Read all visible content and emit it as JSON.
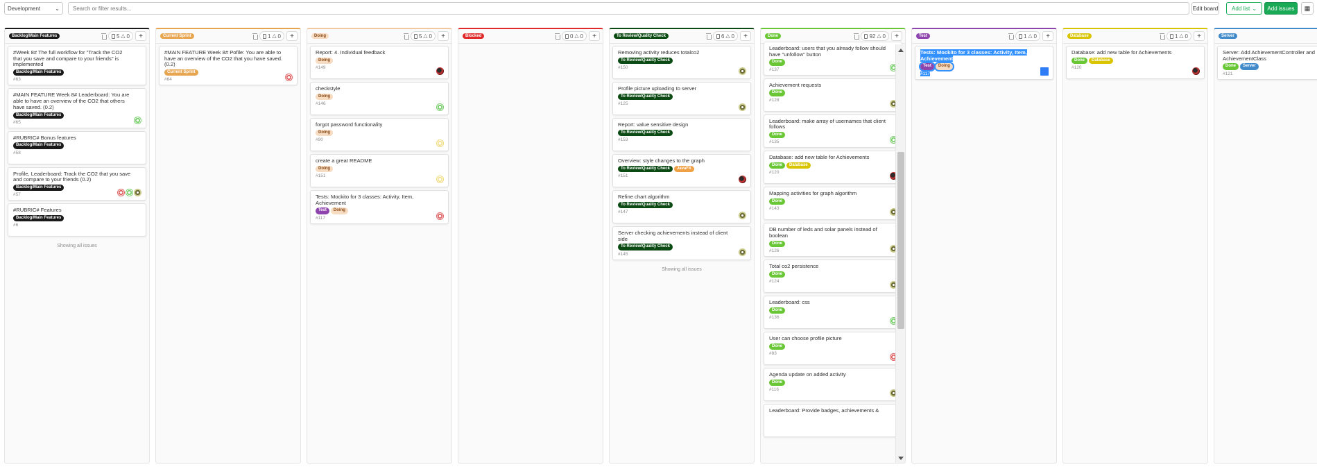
{
  "toolbar": {
    "milestone_select": "Development",
    "search_placeholder": "Search or filter results...",
    "edit_board": "Edit board",
    "add_list": "Add list",
    "add_issues": "Add issues"
  },
  "colors": {
    "backlog": "#1a1a1a",
    "current_sprint": "#e8a550",
    "doing": "#f2c8a0",
    "blocked": "#e02a2a",
    "review": "#0b4a12",
    "done": "#69c735",
    "test": "#8e44ad",
    "database": "#d8c400",
    "server": "#428bca",
    "javafx": "#f0a044"
  },
  "lists": [
    {
      "name": "Backlog/Main Features",
      "issues": "5",
      "weight": "0",
      "footer": "Showing all issues",
      "cards": [
        {
          "title": "#Week 8# The full workflow for \"Track the CO2 that you save and compare to your friends\" is implemented",
          "labels": [
            "Backlog/Main Features"
          ],
          "id": "#63",
          "avatars": []
        },
        {
          "title": "#MAIN FEATURE Week 8# Leaderboard: You are able to have an overview of the CO2 that others have saved. (0.2)",
          "labels": [
            "Backlog/Main Features"
          ],
          "id": "#65",
          "avatars": [
            "green"
          ]
        },
        {
          "title": "#RUBRIC# Bonus features",
          "labels": [
            "Backlog/Main Features"
          ],
          "id": "#58",
          "avatars": []
        },
        {
          "title": "Profile, Leaderboard: Track the CO2 that you save and compare to your friends (0.2)",
          "labels": [
            "Backlog/Main Features"
          ],
          "id": "#57",
          "avatars": [
            "red",
            "green",
            "olive"
          ]
        },
        {
          "title": "#RUBRIC# Features",
          "labels": [
            "Backlog/Main Features"
          ],
          "id": "#6",
          "avatars": []
        }
      ]
    },
    {
      "name": "Current Sprint",
      "issues": "1",
      "weight": "0",
      "cards": [
        {
          "title": "#MAIN FEATURE Week 8# Pofile: You are able to have an overview of the CO2 that you have saved. (0.2)",
          "labels": [
            "Current Sprint"
          ],
          "id": "#64",
          "avatars": [
            "red"
          ]
        }
      ]
    },
    {
      "name": "Doing",
      "issues": "5",
      "weight": "0",
      "cards": [
        {
          "title": "Report: 4. Individual feedback",
          "labels": [
            "Doing"
          ],
          "id": "#149",
          "avatars": [
            "photo"
          ]
        },
        {
          "title": "checkstyle",
          "labels": [
            "Doing"
          ],
          "id": "#146",
          "avatars": [
            "green"
          ]
        },
        {
          "title": "forgot password functionality",
          "labels": [
            "Doing"
          ],
          "id": "#90",
          "avatars": [
            "yellow"
          ]
        },
        {
          "title": "create a great README",
          "labels": [
            "Doing"
          ],
          "id": "#151",
          "avatars": [
            "yellow"
          ]
        },
        {
          "title": "Tests: Mockito for 3 classes: Activity, Item, Achievement",
          "labels": [
            "Test",
            "Doing"
          ],
          "id": "#117",
          "avatars": [
            "red"
          ]
        }
      ]
    },
    {
      "name": "Blocked",
      "issues": "0",
      "weight": "0",
      "cards": []
    },
    {
      "name": "To Review/Quality Check",
      "issues": "6",
      "weight": "0",
      "footer": "Showing all issues",
      "cards": [
        {
          "title": "Removing activity reduces totalco2",
          "labels": [
            "To Review/Quality Check"
          ],
          "id": "#150",
          "avatars": [
            "olive"
          ]
        },
        {
          "title": "Profile picture uploading to server",
          "labels": [
            "To Review/Quality Check"
          ],
          "id": "#125",
          "avatars": [
            "olive"
          ]
        },
        {
          "title": "Report: value sensitive design",
          "labels": [
            "To Review/Quality Check"
          ],
          "id": "#153",
          "avatars": []
        },
        {
          "title": "Overview: style changes to the graph",
          "labels": [
            "To Review/Quality Check",
            "JavaFX"
          ],
          "id": "#151",
          "avatars": [
            "photo"
          ]
        },
        {
          "title": "Refine chart algorithm",
          "labels": [
            "To Review/Quality Check"
          ],
          "id": "#147",
          "avatars": [
            "olive"
          ]
        },
        {
          "title": "Server checking achievements instead of client side",
          "labels": [
            "To Review/Quality Check"
          ],
          "id": "#145",
          "avatars": [
            "olive"
          ]
        }
      ]
    },
    {
      "name": "Done",
      "issues": "92",
      "weight": "0",
      "cards": [
        {
          "title": "Leaderboard: users that you already follow should have \"unfollow\" button",
          "labels": [
            "Done"
          ],
          "id": "#137",
          "avatars": [
            "green"
          ]
        },
        {
          "title": "Achievement requests",
          "labels": [
            "Done"
          ],
          "id": "#128",
          "avatars": [
            "olive"
          ]
        },
        {
          "title": "Leaderboard: make array of usernames that client follows",
          "labels": [
            "Done"
          ],
          "id": "#135",
          "avatars": [
            "green"
          ]
        },
        {
          "title": "Database: add new table for Achievements",
          "labels": [
            "Done",
            "Database"
          ],
          "id": "#120",
          "avatars": [
            "photo"
          ]
        },
        {
          "title": "Mapping activities for graph algorithm",
          "labels": [
            "Done"
          ],
          "id": "#143",
          "avatars": [
            "olive"
          ]
        },
        {
          "title": "DB number of leds and solar panels instead of boolean",
          "labels": [
            "Done"
          ],
          "id": "#126",
          "avatars": [
            "olive"
          ]
        },
        {
          "title": "Total co2 persistence",
          "labels": [
            "Done"
          ],
          "id": "#124",
          "avatars": [
            "olive"
          ]
        },
        {
          "title": "Leaderboard: css",
          "labels": [
            "Done"
          ],
          "id": "#136",
          "avatars": [
            "green"
          ]
        },
        {
          "title": "User can choose profile picture",
          "labels": [
            "Done"
          ],
          "id": "#83",
          "avatars": [
            "red"
          ]
        },
        {
          "title": "Agenda update on added activity",
          "labels": [
            "Done"
          ],
          "id": "#116",
          "avatars": [
            "olive"
          ]
        },
        {
          "title": "Leaderboard: Provide badges, achievements &",
          "labels": [],
          "id": "",
          "avatars": []
        }
      ]
    },
    {
      "name": "Test",
      "issues": "1",
      "weight": "0",
      "cards": [
        {
          "title": "Tests: Mockito for 3 classes: Activity, Item, Achievement",
          "labels": [
            "Test",
            "Doing"
          ],
          "id": "#117",
          "avatars": [
            "blue"
          ],
          "selected": true
        }
      ]
    },
    {
      "name": "Database",
      "issues": "1",
      "weight": "0",
      "cards": [
        {
          "title": "Database: add new table for Achievements",
          "labels": [
            "Done",
            "Database"
          ],
          "id": "#120",
          "avatars": [
            "photo"
          ]
        }
      ]
    },
    {
      "name": "Server",
      "issues": "",
      "weight": "",
      "cards": [
        {
          "title": "Server: Add AchievementController and AchievementClass",
          "labels": [
            "Done",
            "Server"
          ],
          "id": "#121",
          "avatars": []
        }
      ]
    }
  ]
}
